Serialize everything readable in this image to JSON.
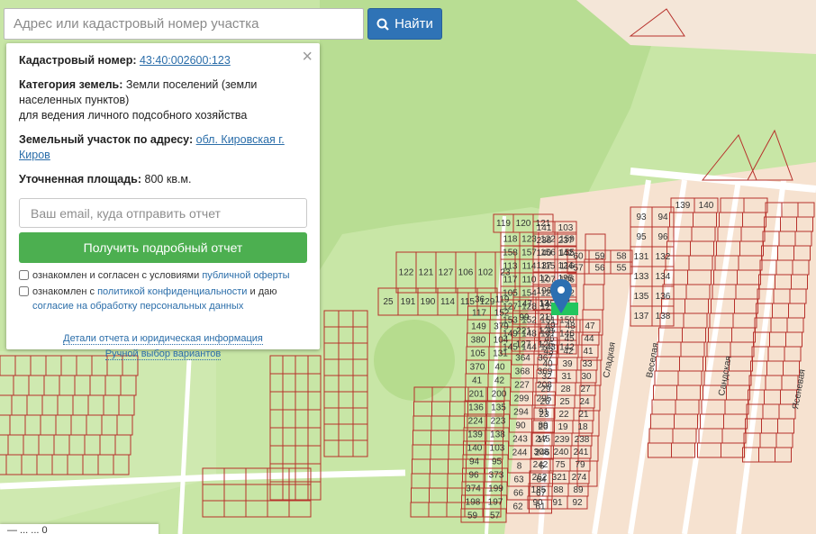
{
  "search": {
    "placeholder": "Адрес или кадастровый номер участка",
    "button_label": "Найти",
    "button_icon": "search-icon"
  },
  "panel": {
    "close_symbol": "×",
    "cadastral_label": "Кадастровый номер:",
    "cadastral_value": "43:40:002600:123",
    "category_label": "Категория земель:",
    "category_value": "Земли поселений (земли населенных пунктов)",
    "category_use": "для ведения личного подсобного хозяйства",
    "address_label": "Земельный участок по адресу:",
    "address_value": "обл. Кировская г. Киров",
    "area_label": "Уточненная площадь:",
    "area_value": "800 кв.м.",
    "email_placeholder": "Ваш email, куда отправить отчет",
    "report_button": "Получить подробный отчет",
    "check1_text": "ознакомлен и согласен с условиями",
    "check1_link": "публичной оферты",
    "check2_text": "ознакомлен с",
    "check2_link": "политикой конфиденциальности",
    "check2_mid": "и даю",
    "check2_link2": "согласие на обработку персональных данных",
    "details_link": "Детали отчета и юридическая информация",
    "manual_link": "Ручной выбор вариантов"
  },
  "bottom_panel": {
    "text": "— ... ... 0"
  },
  "map": {
    "marker_icon": "map-pin-icon",
    "colors": {
      "green": "#c8e6a6",
      "forest": "#b6dc8e",
      "road": "#ffffff",
      "parcel_line": "#b7312b",
      "marker": "#2c6fb1",
      "highlight": "#22c55e"
    },
    "street_labels": [
      "Сладкая",
      "Веселая",
      "Сандская",
      "Ясеневая"
    ],
    "parcel_labels": [
      {
        "t": "119"
      },
      {
        "t": "120"
      },
      {
        "t": "121"
      },
      {
        "t": "118"
      },
      {
        "t": "123"
      },
      {
        "t": "122"
      },
      {
        "t": "159"
      },
      {
        "t": "158"
      },
      {
        "t": "157"
      },
      {
        "t": "156"
      },
      {
        "t": "155"
      },
      {
        "t": "113"
      },
      {
        "t": "114"
      },
      {
        "t": "115"
      },
      {
        "t": "116"
      },
      {
        "t": "117"
      },
      {
        "t": "110"
      },
      {
        "t": "107"
      },
      {
        "t": "106"
      },
      {
        "t": "105"
      },
      {
        "t": "154"
      },
      {
        "t": "126"
      },
      {
        "t": "282"
      },
      {
        "t": "127"
      },
      {
        "t": "128"
      },
      {
        "t": "129"
      },
      {
        "t": "130"
      },
      {
        "t": "153"
      },
      {
        "t": "152"
      },
      {
        "t": "151"
      },
      {
        "t": "150"
      },
      {
        "t": "149"
      },
      {
        "t": "148"
      },
      {
        "t": "147"
      },
      {
        "t": "146"
      },
      {
        "t": "145"
      },
      {
        "t": "144"
      },
      {
        "t": "143"
      },
      {
        "t": "142"
      },
      {
        "t": "141"
      },
      {
        "t": "103"
      },
      {
        "t": "238"
      },
      {
        "t": "237"
      },
      {
        "t": "140"
      },
      {
        "t": "142"
      },
      {
        "t": "137"
      },
      {
        "t": "124"
      },
      {
        "t": "12"
      },
      {
        "t": "195"
      },
      {
        "t": "196"
      },
      {
        "t": "15"
      },
      {
        "t": "13"
      },
      {
        "t": "14"
      },
      {
        "t": "122"
      },
      {
        "t": "121"
      },
      {
        "t": "127"
      },
      {
        "t": "106"
      },
      {
        "t": "102"
      },
      {
        "t": "23"
      },
      {
        "t": "25"
      },
      {
        "t": "191"
      },
      {
        "t": "190"
      },
      {
        "t": "114"
      },
      {
        "t": "115"
      },
      {
        "t": "129"
      },
      {
        "t": "36"
      },
      {
        "t": "119"
      },
      {
        "t": "117"
      },
      {
        "t": "152"
      },
      {
        "t": "149"
      },
      {
        "t": "379"
      },
      {
        "t": "380"
      },
      {
        "t": "104"
      },
      {
        "t": "105"
      },
      {
        "t": "131"
      },
      {
        "t": "370"
      },
      {
        "t": "40"
      },
      {
        "t": "41"
      },
      {
        "t": "42"
      },
      {
        "t": "201"
      },
      {
        "t": "200"
      },
      {
        "t": "136"
      },
      {
        "t": "135"
      },
      {
        "t": "224"
      },
      {
        "t": "223"
      },
      {
        "t": "139"
      },
      {
        "t": "138"
      },
      {
        "t": "140"
      },
      {
        "t": "103"
      },
      {
        "t": "94"
      },
      {
        "t": "95"
      },
      {
        "t": "96"
      },
      {
        "t": "373"
      },
      {
        "t": "374"
      },
      {
        "t": "199"
      },
      {
        "t": "198"
      },
      {
        "t": "197"
      },
      {
        "t": "59"
      },
      {
        "t": "57"
      },
      {
        "t": "147"
      },
      {
        "t": "145"
      },
      {
        "t": "99"
      },
      {
        "t": "211"
      },
      {
        "t": "221"
      },
      {
        "t": "128"
      },
      {
        "t": "127"
      },
      {
        "t": "126"
      },
      {
        "t": "364"
      },
      {
        "t": "367"
      },
      {
        "t": "368"
      },
      {
        "t": "369"
      },
      {
        "t": "227"
      },
      {
        "t": "208"
      },
      {
        "t": "299"
      },
      {
        "t": "295"
      },
      {
        "t": "294"
      },
      {
        "t": "91"
      },
      {
        "t": "90"
      },
      {
        "t": "89"
      },
      {
        "t": "243"
      },
      {
        "t": "245"
      },
      {
        "t": "244"
      },
      {
        "t": "246"
      },
      {
        "t": "8"
      },
      {
        "t": "6"
      },
      {
        "t": "63"
      },
      {
        "t": "64"
      },
      {
        "t": "66"
      },
      {
        "t": "67"
      },
      {
        "t": "62"
      },
      {
        "t": "61"
      },
      {
        "t": "60"
      },
      {
        "t": "59"
      },
      {
        "t": "58"
      },
      {
        "t": "57"
      },
      {
        "t": "56"
      },
      {
        "t": "55"
      },
      {
        "t": "49"
      },
      {
        "t": "48"
      },
      {
        "t": "47"
      },
      {
        "t": "46"
      },
      {
        "t": "45"
      },
      {
        "t": "44"
      },
      {
        "t": "43"
      },
      {
        "t": "42"
      },
      {
        "t": "41"
      },
      {
        "t": "40"
      },
      {
        "t": "39"
      },
      {
        "t": "33"
      },
      {
        "t": "32"
      },
      {
        "t": "31"
      },
      {
        "t": "30"
      },
      {
        "t": "29"
      },
      {
        "t": "28"
      },
      {
        "t": "27"
      },
      {
        "t": "26"
      },
      {
        "t": "25"
      },
      {
        "t": "24"
      },
      {
        "t": "23"
      },
      {
        "t": "22"
      },
      {
        "t": "21"
      },
      {
        "t": "20"
      },
      {
        "t": "19"
      },
      {
        "t": "18"
      },
      {
        "t": "17"
      },
      {
        "t": "239"
      },
      {
        "t": "238"
      },
      {
        "t": "308"
      },
      {
        "t": "240"
      },
      {
        "t": "241"
      },
      {
        "t": "242"
      },
      {
        "t": "75"
      },
      {
        "t": "79"
      },
      {
        "t": "262"
      },
      {
        "t": "321"
      },
      {
        "t": "274"
      },
      {
        "t": "185"
      },
      {
        "t": "88"
      },
      {
        "t": "89"
      },
      {
        "t": "90"
      },
      {
        "t": "91"
      },
      {
        "t": "92"
      },
      {
        "t": "93"
      },
      {
        "t": "94"
      },
      {
        "t": "95"
      },
      {
        "t": "96"
      },
      {
        "t": "131"
      },
      {
        "t": "132"
      },
      {
        "t": "133"
      },
      {
        "t": "134"
      },
      {
        "t": "135"
      },
      {
        "t": "136"
      },
      {
        "t": "137"
      },
      {
        "t": "138"
      },
      {
        "t": "139"
      },
      {
        "t": "140"
      }
    ]
  }
}
